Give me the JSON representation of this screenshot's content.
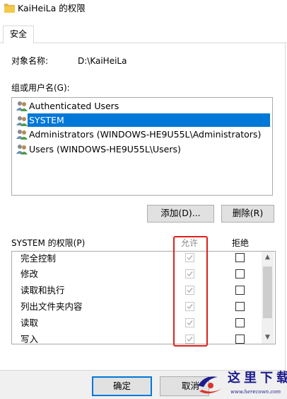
{
  "window": {
    "title": "KaiHeiLa 的权限"
  },
  "tabs": [
    {
      "label": "安全"
    }
  ],
  "object": {
    "label": "对象名称:",
    "value": "D:\\KaiHeiLa"
  },
  "groups": {
    "label": "组或用户名(G):",
    "items": [
      {
        "label": "Authenticated Users"
      },
      {
        "label": "SYSTEM",
        "selected": true
      },
      {
        "label": "Administrators (WINDOWS-HE9U55L\\Administrators)"
      },
      {
        "label": "Users (WINDOWS-HE9U55L\\Users)"
      }
    ],
    "add_label": "添加(D)...",
    "remove_label": "删除(R)"
  },
  "permissions": {
    "header": "SYSTEM 的权限(P)",
    "allow_label": "允许",
    "deny_label": "拒绝",
    "rows": [
      {
        "label": "完全控制",
        "allow": true,
        "deny": false
      },
      {
        "label": "修改",
        "allow": true,
        "deny": false
      },
      {
        "label": "读取和执行",
        "allow": true,
        "deny": false
      },
      {
        "label": "列出文件夹内容",
        "allow": true,
        "deny": false
      },
      {
        "label": "读取",
        "allow": true,
        "deny": false
      },
      {
        "label": "写入",
        "allow": true,
        "deny": false
      }
    ]
  },
  "footer": {
    "ok_label": "确定",
    "cancel_label": "取消"
  },
  "watermark": {
    "text": "这里下载",
    "url": "www.herecown.com"
  },
  "colors": {
    "selection": "#0078d7",
    "highlight_frame": "#e0201b",
    "folder": "#e8b84a"
  }
}
